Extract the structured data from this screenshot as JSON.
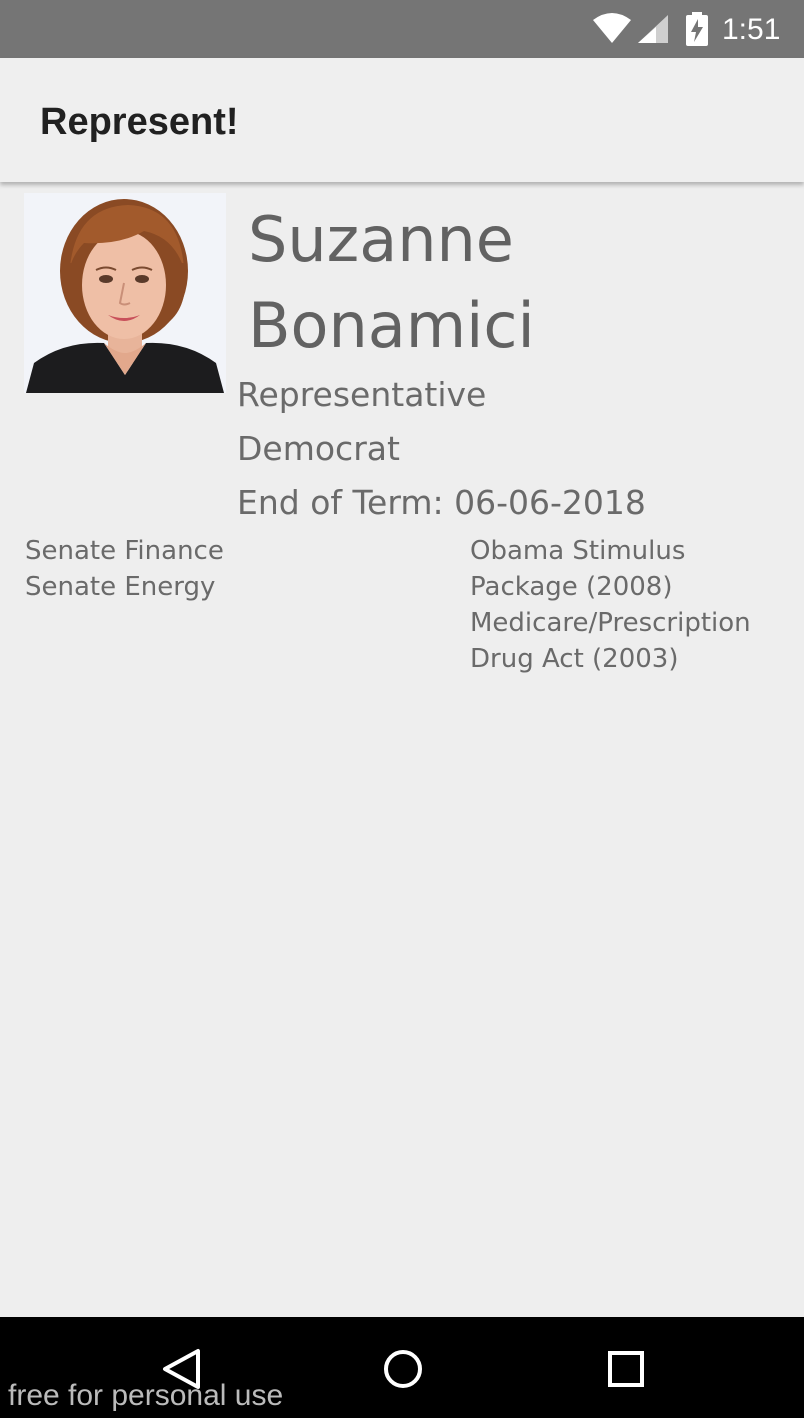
{
  "status_bar": {
    "time": "1:51",
    "icons": [
      "wifi-icon",
      "signal-icon",
      "battery-charging-icon"
    ]
  },
  "app_bar": {
    "title": "Represent!"
  },
  "representative": {
    "photo_icon": "portrait-photo",
    "name": "Suzanne Bonamici",
    "title": "Representative",
    "party": "Democrat",
    "term_label": "End of Term:",
    "term_end": "06-06-2018",
    "committees": [
      "Senate Finance",
      "Senate Energy"
    ],
    "bills": [
      "Obama Stimulus",
      "Package (2008)",
      "Medicare/Prescription",
      "Drug Act (2003)"
    ]
  },
  "nav_bar": {
    "icons": [
      "back-icon",
      "home-icon",
      "recents-icon"
    ]
  },
  "watermark": "free for personal use",
  "colors": {
    "status_bar": "#757575",
    "app_bar": "#efefef",
    "background": "#eeeeee",
    "text": "#6a6a6a",
    "nav_bar": "#000000"
  }
}
